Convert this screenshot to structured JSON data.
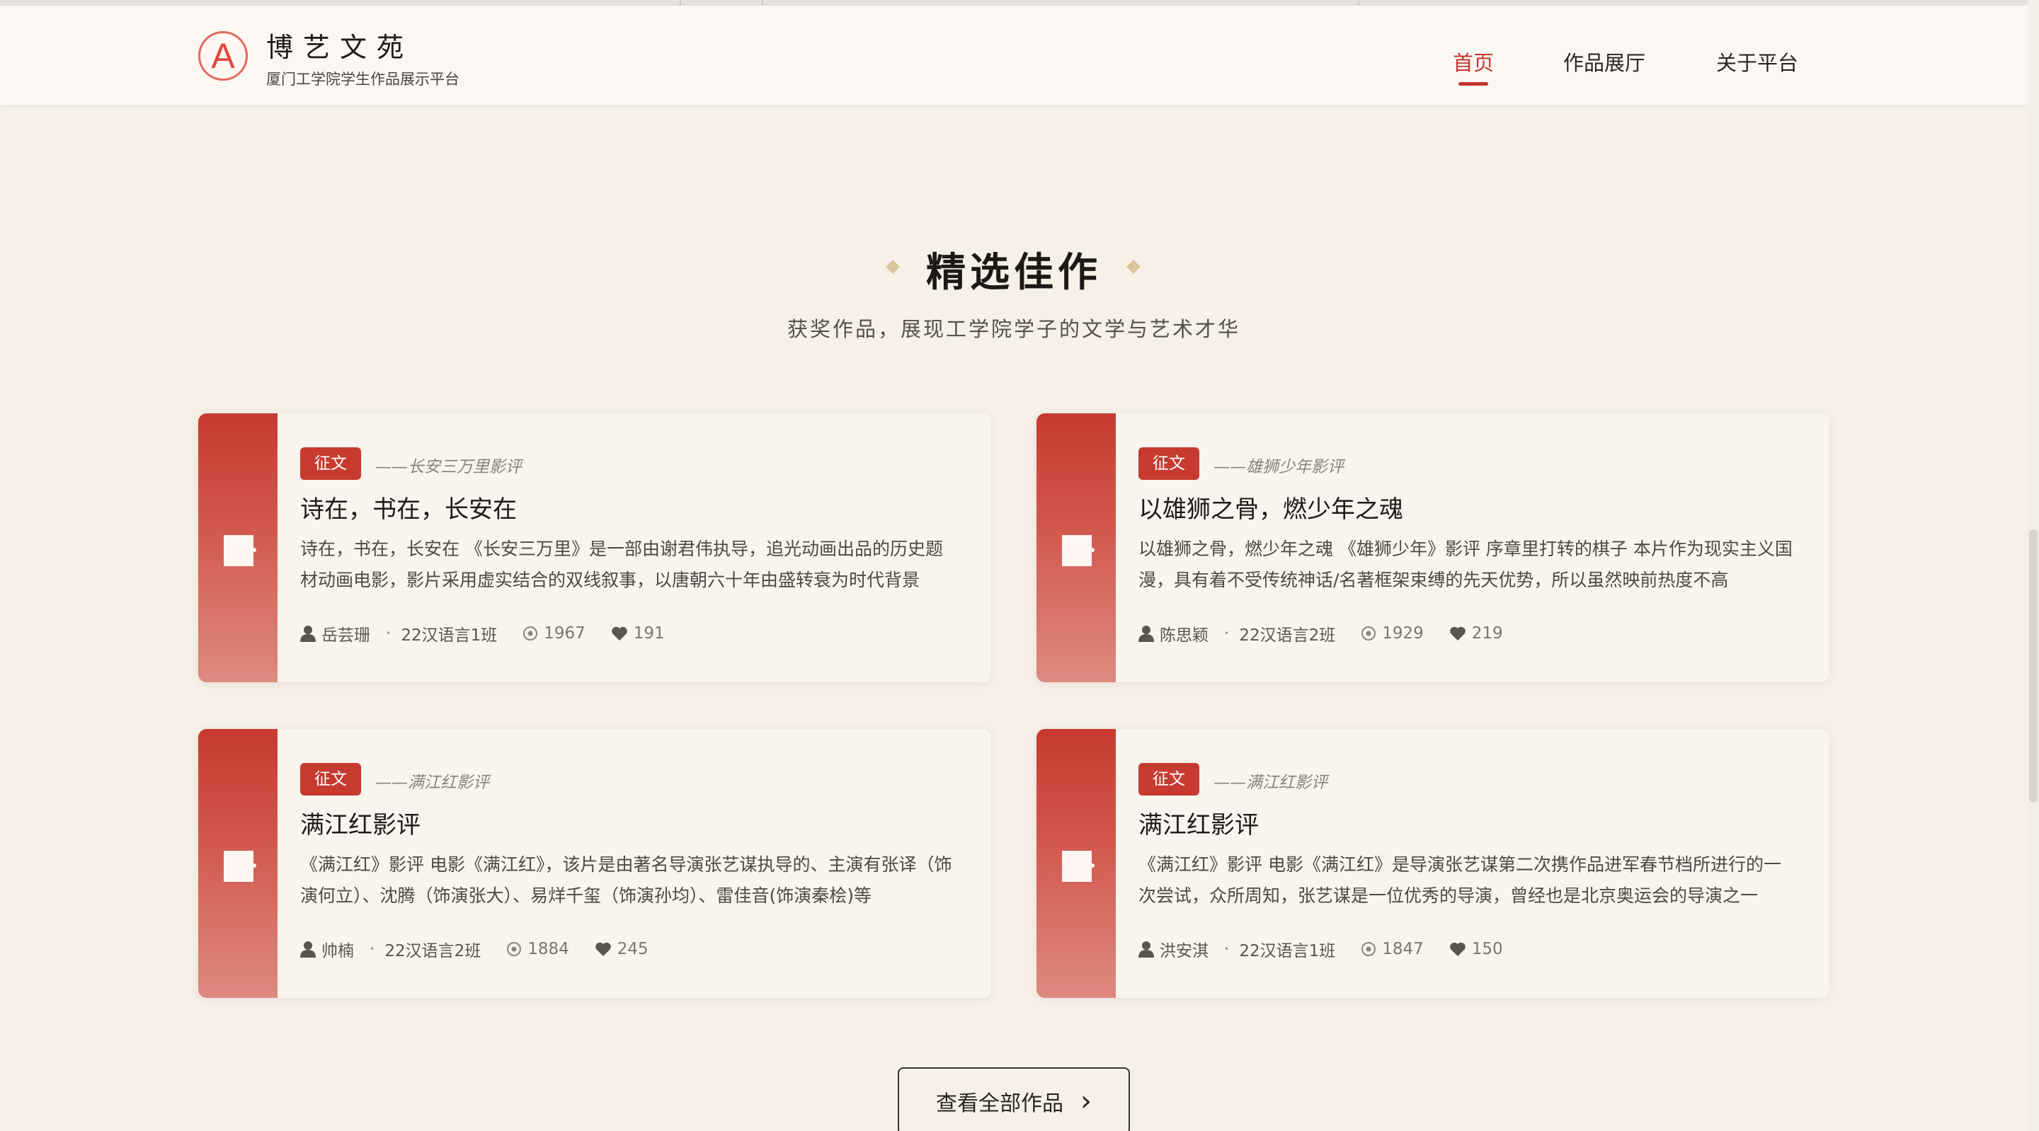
{
  "brand": {
    "logo_letter": "A",
    "title": "博艺文苑",
    "subtitle": "厦门工学院学生作品展示平台"
  },
  "nav": {
    "items": [
      {
        "label": "首页",
        "active": true
      },
      {
        "label": "作品展厅",
        "active": false
      },
      {
        "label": "关于平台",
        "active": false
      }
    ]
  },
  "section": {
    "title": "精选佳作",
    "subtitle": "获奖作品，展现工学院学子的文学与艺术才华"
  },
  "cards": [
    {
      "badge": "征文",
      "source": "——长安三万里影评",
      "title": "诗在，书在，长安在",
      "excerpt": "诗在，书在，长安在 《长安三万里》是一部由谢君伟执导，追光动画出品的历史题材动画电影，影片采用虚实结合的双线叙事，以唐朝六十年由盛转衰为时代背景",
      "author": "岳芸珊",
      "class": "22汉语言1班",
      "views": "1967",
      "likes": "191"
    },
    {
      "badge": "征文",
      "source": "——雄狮少年影评",
      "title": "以雄狮之骨，燃少年之魂",
      "excerpt": "以雄狮之骨，燃少年之魂 《雄狮少年》影评 序章里打转的棋子 本片作为现实主义国漫，具有着不受传统神话/名著框架束缚的先天优势，所以虽然映前热度不高",
      "author": "陈思颖",
      "class": "22汉语言2班",
      "views": "1929",
      "likes": "219"
    },
    {
      "badge": "征文",
      "source": "——满江红影评",
      "title": "满江红影评",
      "excerpt": "《满江红》影评 电影《满江红》，该片是由著名导演张艺谋执导的、主演有张译（饰演何立）、沈腾（饰演张大）、易烊千玺（饰演孙均）、雷佳音(饰演秦桧)等",
      "author": "帅楠",
      "class": "22汉语言2班",
      "views": "1884",
      "likes": "245"
    },
    {
      "badge": "征文",
      "source": "——满江红影评",
      "title": "满江红影评",
      "excerpt": "《满江红》影评 电影《满江红》是导演张艺谋第二次携作品进军春节档所进行的一次尝试，众所周知，张艺谋是一位优秀的导演，曾经也是北京奥运会的导演之一",
      "author": "洪安淇",
      "class": "22汉语言1班",
      "views": "1847",
      "likes": "150"
    }
  ],
  "view_all": {
    "label": "查看全部作品",
    "arrow": "›"
  },
  "colors": {
    "accent": "#c63a2f",
    "background": "#f6f0e7",
    "card": "#f9f4ed",
    "gold": "#dcc59a"
  },
  "icons": {
    "author": "person-icon",
    "views": "eye-icon",
    "likes": "heart-icon",
    "arrow": "chevron-right-icon"
  }
}
